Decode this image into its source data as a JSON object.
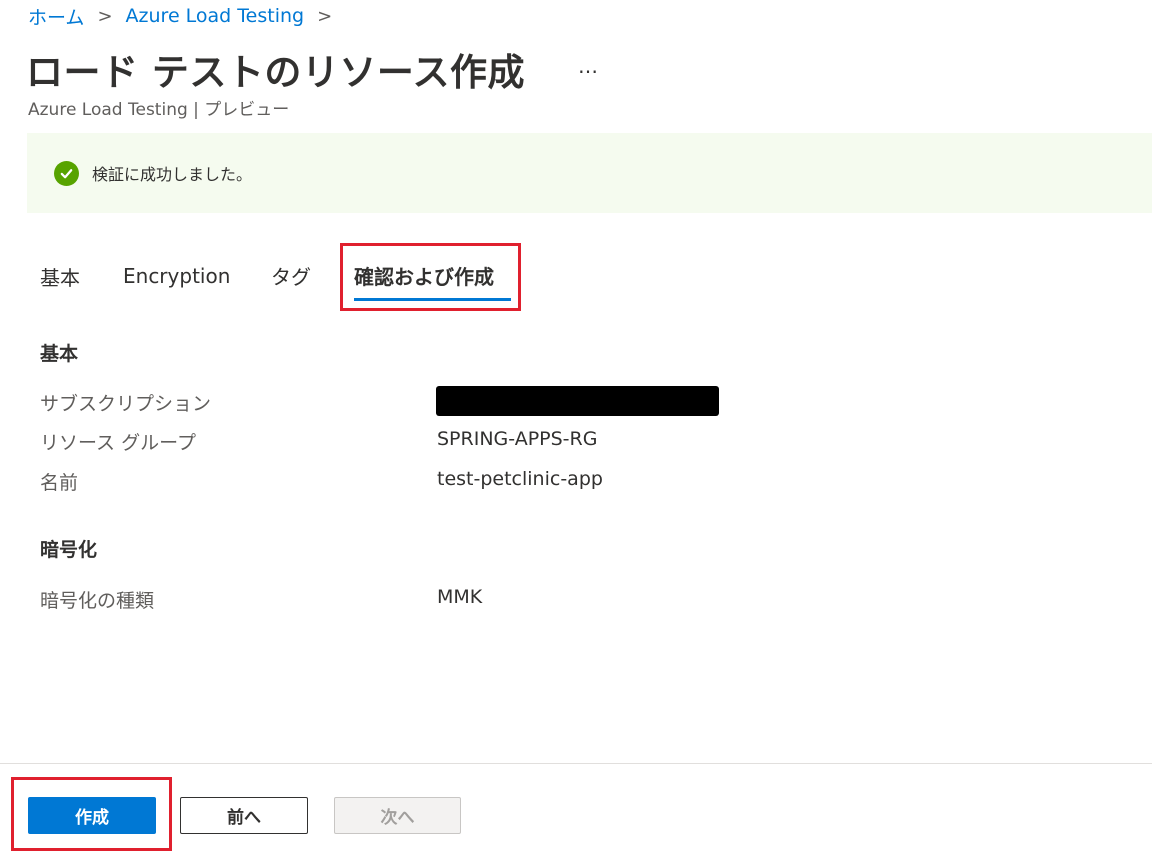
{
  "breadcrumb": {
    "home": "ホーム",
    "service": "Azure Load Testing",
    "separator": ">"
  },
  "header": {
    "title": "ロード テストのリソース作成",
    "more": "…",
    "subtitle": "Azure Load Testing | プレビュー"
  },
  "banner": {
    "message": "検証に成功しました。",
    "status_color": "#57a300"
  },
  "tabs": [
    {
      "label": "基本"
    },
    {
      "label": "Encryption"
    },
    {
      "label": "タグ"
    },
    {
      "label": "確認および作成",
      "selected": true
    }
  ],
  "basics": {
    "heading": "基本",
    "rows": [
      {
        "label": "サブスクリプション",
        "value": ""
      },
      {
        "label": "リソース グループ",
        "value": "SPRING-APPS-RG"
      },
      {
        "label": "名前",
        "value": "test-petclinic-app"
      }
    ]
  },
  "encryption": {
    "heading": "暗号化",
    "rows": [
      {
        "label": "暗号化の種類",
        "value": "MMK"
      }
    ]
  },
  "footer": {
    "create_label": "作成",
    "prev_label": "前へ",
    "next_label": "次へ"
  },
  "colors": {
    "accent": "#0078d4",
    "highlight": "#e0202e"
  }
}
